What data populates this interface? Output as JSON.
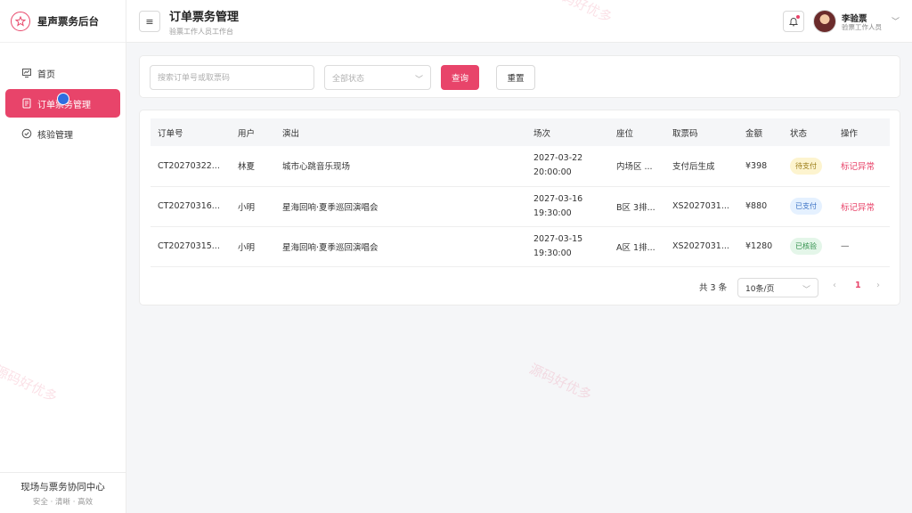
{
  "brand": {
    "name": "星声票务后台"
  },
  "sidebar": {
    "items": [
      {
        "label": "首页",
        "icon": "dashboard-icon",
        "active": false
      },
      {
        "label": "订单票务管理",
        "icon": "document-icon",
        "active": true
      },
      {
        "label": "核验管理",
        "icon": "check-circle-icon",
        "active": false
      }
    ],
    "footer_title": "现场与票务协同中心",
    "footer_sub": "安全 · 清晰 · 高效"
  },
  "header": {
    "menu_icon": "≡",
    "title": "订单票务管理",
    "subtitle": "验票工作人员工作台",
    "user_name": "李验票",
    "user_role": "验票工作人员"
  },
  "filters": {
    "search_placeholder": "搜索订单号或取票码",
    "status_placeholder": "全部状态",
    "query_label": "查询",
    "reset_label": "重置"
  },
  "table": {
    "columns": [
      "订单号",
      "用户",
      "演出",
      "场次",
      "座位",
      "取票码",
      "金额",
      "状态",
      "操作"
    ],
    "rows": [
      {
        "order_no": "CT20270322...",
        "user": "林夏",
        "show": "城市心跳音乐现场",
        "date": "2027-03-22",
        "time": "20:00:00",
        "seat": "内场区 ...",
        "code": "支付后生成",
        "amount": "¥398",
        "status": "待支付",
        "status_type": "pending",
        "action": "标记异常"
      },
      {
        "order_no": "CT20270316...",
        "user": "小明",
        "show": "星海回响·夏季巡回演唱会",
        "date": "2027-03-16",
        "time": "19:30:00",
        "seat": "B区 3排...",
        "code": "XS2027031...",
        "amount": "¥880",
        "status": "已支付",
        "status_type": "paid",
        "action": "标记异常"
      },
      {
        "order_no": "CT20270315...",
        "user": "小明",
        "show": "星海回响·夏季巡回演唱会",
        "date": "2027-03-15",
        "time": "19:30:00",
        "seat": "A区 1排...",
        "code": "XS2027031...",
        "amount": "¥1280",
        "status": "已核验",
        "status_type": "checked",
        "action": "—"
      }
    ]
  },
  "pagination": {
    "total": "共 3 条",
    "page_size": "10条/页",
    "current_page": "1"
  },
  "watermark": "源码好优多",
  "colors": {
    "accent": "#e8446a",
    "pending": "#fdf4cf",
    "paid": "#e5f1ff",
    "checked": "#e4f6e9"
  }
}
